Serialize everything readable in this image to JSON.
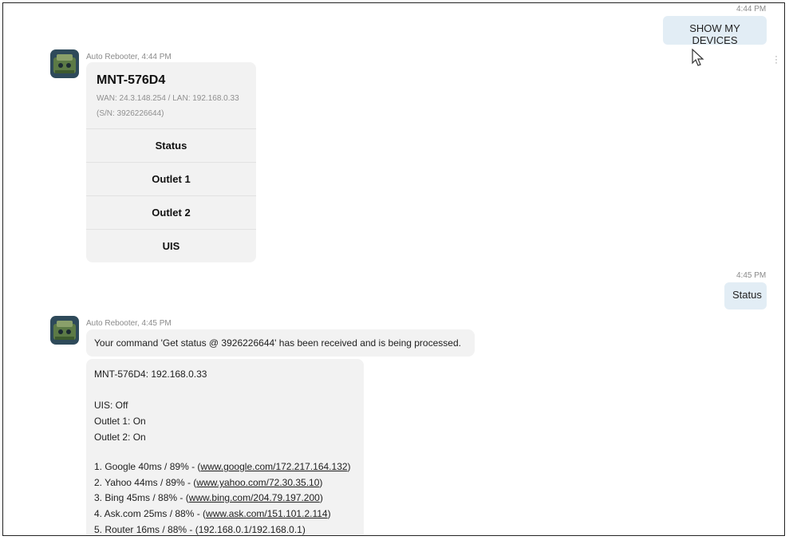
{
  "chat": {
    "user_messages": [
      {
        "time": "4:44 PM",
        "text": "SHOW MY DEVICES"
      },
      {
        "time": "4:45 PM",
        "text": "Status"
      }
    ],
    "bot_messages": [
      {
        "sender": "Auto Rebooter, 4:44 PM",
        "card": {
          "title": "MNT-576D4",
          "wan_lan": "WAN: 24.3.148.254 / LAN: 192.168.0.33",
          "serial": "(S/N: 3926226644)",
          "buttons": [
            "Status",
            "Outlet 1",
            "Outlet 2",
            "UIS"
          ]
        }
      },
      {
        "sender": "Auto Rebooter, 4:45 PM",
        "ack": "Your command 'Get status @ 3926226644' has been received and is being processed.",
        "status": {
          "device_line": "MNT-576D4: 192.168.0.33",
          "uis": "UIS: Off",
          "outlet1": "Outlet 1: On",
          "outlet2": "Outlet 2: On",
          "pings": [
            {
              "prefix": "1. Google 40ms / 89% - (",
              "link": "www.google.com/172.217.164.132",
              "suffix": ")"
            },
            {
              "prefix": "2. Yahoo 44ms / 89% - (",
              "link": "www.yahoo.com/72.30.35.10",
              "suffix": ")"
            },
            {
              "prefix": "3. Bing 45ms / 88% - (",
              "link": "www.bing.com/204.79.197.200",
              "suffix": ")"
            },
            {
              "prefix": "4. Ask.com 25ms / 88% - (",
              "link": "www.ask.com/151.101.2.114",
              "suffix": ")"
            },
            {
              "prefix": "5. Router 16ms / 88% - (192.168.0.1/192.168.0.1)",
              "link": "",
              "suffix": ""
            }
          ]
        }
      }
    ]
  },
  "icons": {
    "avatar": "robot-device-icon",
    "cursor": "mouse-pointer-icon",
    "menu": "more-vertical-icon"
  }
}
